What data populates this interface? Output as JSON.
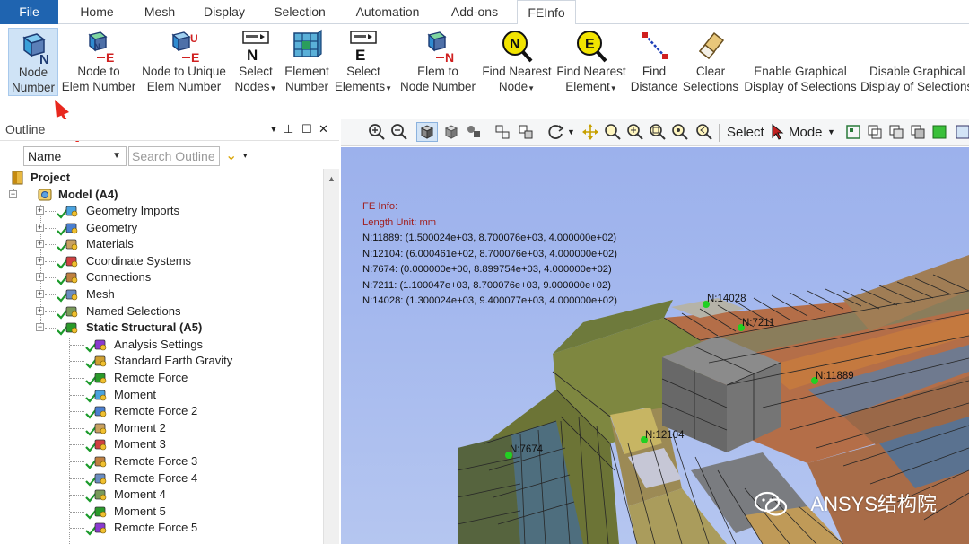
{
  "menu": {
    "tabs": [
      "File",
      "Home",
      "Mesh",
      "Display",
      "Selection",
      "Automation",
      "Add-ons",
      "FEInfo"
    ],
    "active_tab": "FEInfo"
  },
  "ribbon": {
    "buttons": [
      {
        "line1": "Node",
        "line2": "Number",
        "icon": "node-number-icon"
      },
      {
        "line1": "Node to",
        "line2": "Elem Number",
        "icon": "node-to-elem-icon"
      },
      {
        "line1": "Node to Unique",
        "line2": "Elem Number",
        "icon": "node-to-unique-elem-icon"
      },
      {
        "line1": "Select",
        "line2": "Nodes",
        "icon": "select-nodes-icon"
      },
      {
        "line1": "Element",
        "line2": "Number",
        "icon": "element-number-icon"
      },
      {
        "line1": "Select",
        "line2": "Elements",
        "icon": "select-elements-icon"
      },
      {
        "line1": "Elem to",
        "line2": "Node Number",
        "icon": "elem-to-node-icon"
      },
      {
        "line1": "Find Nearest",
        "line2": "Node",
        "icon": "find-nearest-node-icon"
      },
      {
        "line1": "Find Nearest",
        "line2": "Element",
        "icon": "find-nearest-element-icon"
      },
      {
        "line1": "Find",
        "line2": "Distance",
        "icon": "find-distance-icon"
      },
      {
        "line1": "Clear",
        "line2": "Selections",
        "icon": "clear-selections-icon"
      },
      {
        "line1": "Enable Graphical",
        "line2": "Display of Selections",
        "icon": ""
      },
      {
        "line1": "Disable Graphical",
        "line2": "Display of Selections",
        "icon": ""
      }
    ]
  },
  "outline": {
    "title": "Outline",
    "filter_selected": "Name",
    "search_placeholder": "Search Outline",
    "tree": [
      {
        "label": "Project",
        "level": 0,
        "bold": true
      },
      {
        "label": "Model (A4)",
        "level": 1,
        "bold": true
      },
      {
        "label": "Geometry Imports",
        "level": 2
      },
      {
        "label": "Geometry",
        "level": 2
      },
      {
        "label": "Materials",
        "level": 2
      },
      {
        "label": "Coordinate Systems",
        "level": 2
      },
      {
        "label": "Connections",
        "level": 2
      },
      {
        "label": "Mesh",
        "level": 2
      },
      {
        "label": "Named Selections",
        "level": 2
      },
      {
        "label": "Static Structural (A5)",
        "level": 2,
        "bold": true
      },
      {
        "label": "Analysis Settings",
        "level": 3
      },
      {
        "label": "Standard Earth Gravity",
        "level": 3
      },
      {
        "label": "Remote Force",
        "level": 3
      },
      {
        "label": "Moment",
        "level": 3
      },
      {
        "label": "Remote Force 2",
        "level": 3
      },
      {
        "label": "Moment 2",
        "level": 3
      },
      {
        "label": "Moment 3",
        "level": 3
      },
      {
        "label": "Remote Force 3",
        "level": 3
      },
      {
        "label": "Remote Force 4",
        "level": 3
      },
      {
        "label": "Moment 4",
        "level": 3
      },
      {
        "label": "Moment 5",
        "level": 3
      },
      {
        "label": "Remote Force 5",
        "level": 3
      }
    ]
  },
  "graphics_toolbar": {
    "select_label": "Select",
    "mode_label": "Mode"
  },
  "viewport": {
    "info_title": "FE Info:",
    "length_unit": "Length Unit: mm",
    "node_lines": [
      "N:11889: (1.500024e+03, 8.700076e+03, 4.000000e+02)",
      "N:12104: (6.000461e+02, 8.700076e+03, 4.000000e+02)",
      "N:7674: (0.000000e+00, 8.899754e+03, 4.000000e+02)",
      "N:7211: (1.100047e+03, 8.700076e+03, 9.000000e+02)",
      "N:14028: (1.300024e+03, 9.400077e+03, 4.000000e+02)"
    ],
    "node_markers": [
      "N:14028",
      "N:7211",
      "N:11889",
      "N:12104",
      "N:7674"
    ],
    "watermark": "ANSYS结构院"
  },
  "colors": {
    "file_tab": "#1f64b0",
    "viewport_bg": "#a4b8ee",
    "info_red": "#a02020",
    "node_marker": "#22d022",
    "annotation_arrow": "#e8281e"
  }
}
